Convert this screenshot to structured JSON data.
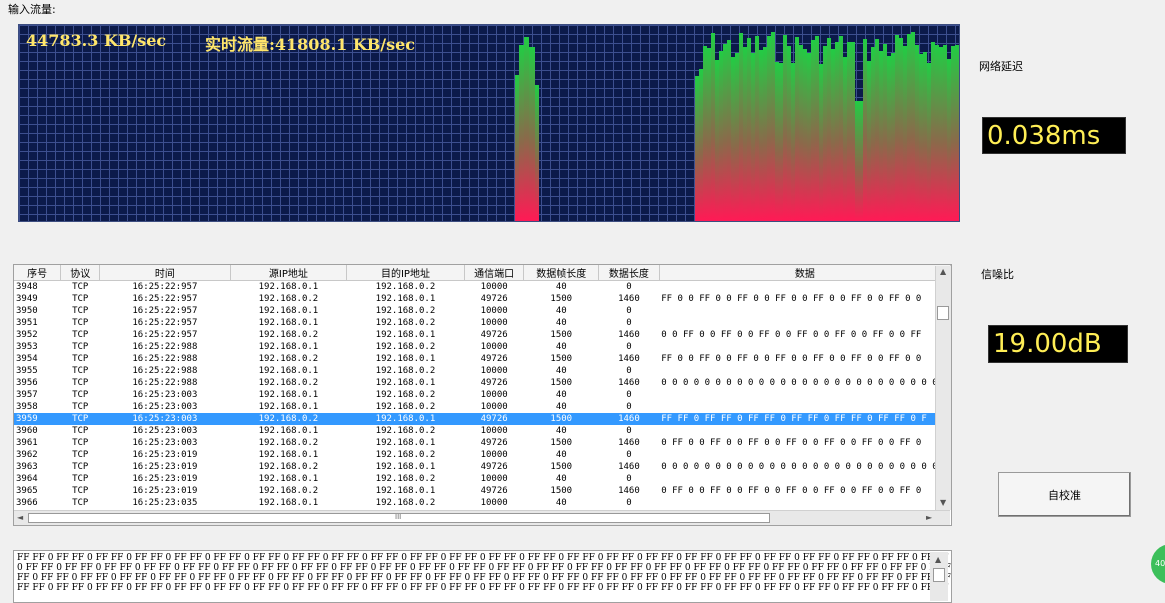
{
  "labels": {
    "input_traffic": "输入流量:",
    "latency": "网络延迟",
    "snr": "信噪比",
    "calibrate": "自校准"
  },
  "chart": {
    "avg_rate": "44783.3 KB/sec",
    "realtime_rate": "实时流量:41808.1 KB/sec"
  },
  "metrics": {
    "latency": "0.038ms",
    "snr": "19.00dB"
  },
  "colors": {
    "chart_bg": "#0c1a4a",
    "bar_top": "#22cc44",
    "bar_bottom": "#ff1a55",
    "lcd_text": "#ffee55",
    "selected_row": "#3399ff"
  },
  "table": {
    "columns": [
      "序号",
      "协议",
      "时间",
      "源IP地址",
      "目的IP地址",
      "通信端口",
      "数据帧长度",
      "数据长度",
      "数据"
    ],
    "rows": [
      [
        "3948",
        "TCP",
        "16:25:22:957",
        "192.168.0.1",
        "192.168.0.2",
        "10000",
        "40",
        "0",
        ""
      ],
      [
        "3949",
        "TCP",
        "16:25:22:957",
        "192.168.0.2",
        "192.168.0.1",
        "49726",
        "1500",
        "1460",
        "FF 0 0 FF 0 0 FF 0 0 FF 0 0 FF 0 0 FF 0 0 FF 0 0"
      ],
      [
        "3950",
        "TCP",
        "16:25:22:957",
        "192.168.0.1",
        "192.168.0.2",
        "10000",
        "40",
        "0",
        ""
      ],
      [
        "3951",
        "TCP",
        "16:25:22:957",
        "192.168.0.1",
        "192.168.0.2",
        "10000",
        "40",
        "0",
        ""
      ],
      [
        "3952",
        "TCP",
        "16:25:22:957",
        "192.168.0.2",
        "192.168.0.1",
        "49726",
        "1500",
        "1460",
        "0 0 FF 0 0 FF 0 0 FF 0 0 FF 0 0 FF 0 0 FF 0 0 FF"
      ],
      [
        "3953",
        "TCP",
        "16:25:22:988",
        "192.168.0.1",
        "192.168.0.2",
        "10000",
        "40",
        "0",
        ""
      ],
      [
        "3954",
        "TCP",
        "16:25:22:988",
        "192.168.0.2",
        "192.168.0.1",
        "49726",
        "1500",
        "1460",
        "FF 0 0 FF 0 0 FF 0 0 FF 0 0 FF 0 0 FF 0 0 FF 0 0"
      ],
      [
        "3955",
        "TCP",
        "16:25:22:988",
        "192.168.0.1",
        "192.168.0.2",
        "10000",
        "40",
        "0",
        ""
      ],
      [
        "3956",
        "TCP",
        "16:25:22:988",
        "192.168.0.2",
        "192.168.0.1",
        "49726",
        "1500",
        "1460",
        "0 0 0 0 0 0 0 0 0 0 0 0 0 0 0 0 0 0 0 0 0 0 0 0 0 0 0"
      ],
      [
        "3957",
        "TCP",
        "16:25:23:003",
        "192.168.0.1",
        "192.168.0.2",
        "10000",
        "40",
        "0",
        ""
      ],
      [
        "3958",
        "TCP",
        "16:25:23:003",
        "192.168.0.1",
        "192.168.0.2",
        "10000",
        "40",
        "0",
        ""
      ],
      [
        "3959",
        "TCP",
        "16:25:23:003",
        "192.168.0.2",
        "192.168.0.1",
        "49726",
        "1500",
        "1460",
        "FF FF 0 FF FF 0 FF FF 0 FF FF 0 FF FF 0 FF FF 0 F"
      ],
      [
        "3960",
        "TCP",
        "16:25:23:003",
        "192.168.0.1",
        "192.168.0.2",
        "10000",
        "40",
        "0",
        ""
      ],
      [
        "3961",
        "TCP",
        "16:25:23:003",
        "192.168.0.2",
        "192.168.0.1",
        "49726",
        "1500",
        "1460",
        "0 FF 0 0 FF 0 0 FF 0 0 FF 0 0 FF 0 0 FF 0 0 FF 0"
      ],
      [
        "3962",
        "TCP",
        "16:25:23:019",
        "192.168.0.1",
        "192.168.0.2",
        "10000",
        "40",
        "0",
        ""
      ],
      [
        "3963",
        "TCP",
        "16:25:23:019",
        "192.168.0.2",
        "192.168.0.1",
        "49726",
        "1500",
        "1460",
        "0 0 0 0 0 0 0 0 0 0 0 0 0 0 0 0 0 0 0 0 0 0 0 0 0 0 0"
      ],
      [
        "3964",
        "TCP",
        "16:25:23:019",
        "192.168.0.1",
        "192.168.0.2",
        "10000",
        "40",
        "0",
        ""
      ],
      [
        "3965",
        "TCP",
        "16:25:23:019",
        "192.168.0.2",
        "192.168.0.1",
        "49726",
        "1500",
        "1460",
        "0 FF 0 0 FF 0 0 FF 0 0 FF 0 0 FF 0 0 FF 0 0 FF 0"
      ],
      [
        "3966",
        "TCP",
        "16:25:23:035",
        "192.168.0.1",
        "192.168.0.2",
        "10000",
        "40",
        "0",
        ""
      ]
    ],
    "selected_index": 11,
    "scroll_marker": "III"
  },
  "payload": {
    "lines": [
      "FF FF 0 FF FF 0 FF FF 0 FF FF 0 FF FF 0 FF FF 0 FF FF 0 FF FF 0 FF FF 0 FF FF 0 FF FF 0 FF FF 0 FF FF 0 FF FF 0 FF FF 0 FF FF 0 FF FF 0 FF FF 0 FF FF 0 FF FF 0 FF FF 0 FF FF 0 FF FF 0 FF FF 0 FF FF 0 FF FF 0 FF FF 0 FF",
      "0 FF FF 0 FF FF 0 FF FF 0 FF FF 0 FF FF 0 FF FF 0 FF FF 0 FF FF 0 FF FF 0 FF FF 0 FF FF 0 FF FF 0 FF FF 0 FF FF 0 FF FF 0 FF FF 0 FF FF 0 FF FF 0 FF FF 0 FF FF 0 FF FF 0 FF FF 0 FF FF 0 FF FF 0 FF FF 0 FF FF 0 FF FF 0 FF FF",
      "FF 0 FF FF 0 FF FF 0 FF FF 0 FF FF 0 FF FF 0 FF FF 0 FF FF 0 FF FF 0 FF FF 0 FF FF 0 FF FF 0 FF FF 0 FF FF 0 FF FF 0 FF FF 0 FF FF 0 FF FF 0 FF FF 0 FF FF 0 FF FF 0 FF FF 0 FF FF 0 FF FF 0 FF FF 0 FF FF 0 FF FF 0 FF",
      "FF FF 0 FF FF 0 FF FF 0 FF FF 0 FF FF 0 FF FF 0 FF FF 0 FF FF 0 FF FF 0 FF FF 0 FF FF 0 FF FF 0 FF FF 0 FF FF 0 FF FF 0 FF FF 0 FF FF 0 FF FF 0 FF FF 0 FF FF 0 FF FF 0 FF FF 0 FF FF 0 FF FF 0 FF FF 0 FF FF 0 FF"
    ]
  },
  "badge": "40"
}
